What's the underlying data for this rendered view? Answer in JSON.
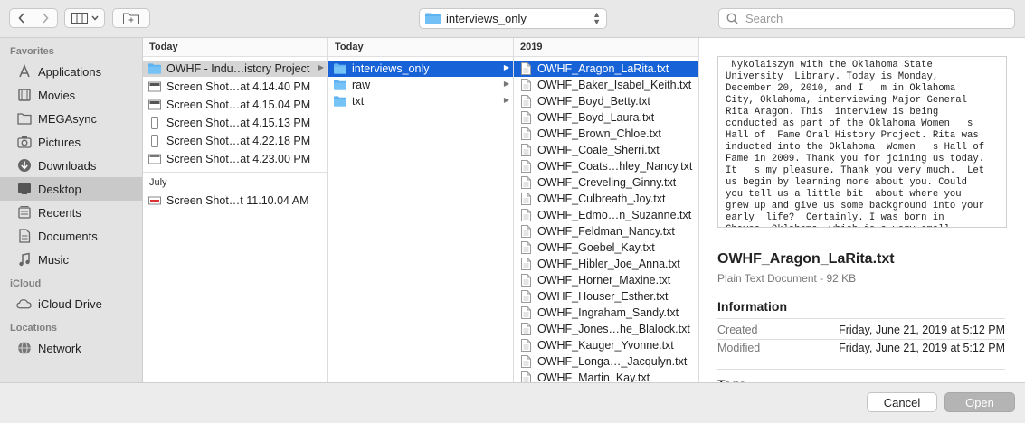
{
  "toolbar": {
    "back_icon": "chevron-left-icon",
    "forward_icon": "chevron-right-icon",
    "view_icon": "column-view-icon",
    "new_folder_icon": "new-folder-icon",
    "location": "interviews_only",
    "search_placeholder": "Search"
  },
  "sidebar": {
    "favorites_heading": "Favorites",
    "favorites": [
      {
        "label": "Applications",
        "icon": "applications-icon"
      },
      {
        "label": "Movies",
        "icon": "movies-icon"
      },
      {
        "label": "MEGAsync",
        "icon": "folder-icon"
      },
      {
        "label": "Pictures",
        "icon": "camera-icon"
      },
      {
        "label": "Downloads",
        "icon": "download-icon"
      },
      {
        "label": "Desktop",
        "icon": "desktop-icon",
        "selected": true
      },
      {
        "label": "Recents",
        "icon": "recents-icon"
      },
      {
        "label": "Documents",
        "icon": "document-icon"
      },
      {
        "label": "Music",
        "icon": "music-icon"
      }
    ],
    "icloud_heading": "iCloud",
    "icloud": [
      {
        "label": "iCloud Drive",
        "icon": "cloud-icon"
      }
    ],
    "locations_heading": "Locations",
    "locations": [
      {
        "label": "Network",
        "icon": "globe-icon"
      }
    ]
  },
  "col1": {
    "header": "Today",
    "items": [
      {
        "label": "OWHF - Indu…istory Project",
        "kind": "folder",
        "selected": true,
        "arrow": true
      },
      {
        "label": "Screen Shot…at 4.14.40 PM",
        "kind": "screenshot"
      },
      {
        "label": "Screen Shot…at 4.15.04 PM",
        "kind": "screenshot"
      },
      {
        "label": "Screen Shot…at 4.15.13 PM",
        "kind": "phone"
      },
      {
        "label": "Screen Shot…at 4.22.18 PM",
        "kind": "phone"
      },
      {
        "label": "Screen Shot…at 4.23.00 PM",
        "kind": "screenshot"
      }
    ],
    "group2_label": "July",
    "group2_items": [
      {
        "label": "Screen Shot…t 11.10.04 AM",
        "kind": "screenshot-red"
      }
    ]
  },
  "col2": {
    "header": "Today",
    "items": [
      {
        "label": "interviews_only",
        "selected": true
      },
      {
        "label": "raw"
      },
      {
        "label": "txt"
      }
    ]
  },
  "col3": {
    "header": "2019",
    "items": [
      "OWHF_Aragon_LaRita.txt",
      "OWHF_Baker_Isabel_Keith.txt",
      "OWHF_Boyd_Betty.txt",
      "OWHF_Boyd_Laura.txt",
      "OWHF_Brown_Chloe.txt",
      "OWHF_Coale_Sherri.txt",
      "OWHF_Coats…hley_Nancy.txt",
      "OWHF_Creveling_Ginny.txt",
      "OWHF_Culbreath_Joy.txt",
      "OWHF_Edmo…n_Suzanne.txt",
      "OWHF_Feldman_Nancy.txt",
      "OWHF_Goebel_Kay.txt",
      "OWHF_Hibler_Joe_Anna.txt",
      "OWHF_Horner_Maxine.txt",
      "OWHF_Houser_Esther.txt",
      "OWHF_Ingraham_Sandy.txt",
      "OWHF_Jones…he_Blalock.txt",
      "OWHF_Kauger_Yvonne.txt",
      "OWHF_Longa…_Jacqulyn.txt",
      "OWHF_Martin_Kay.txt"
    ]
  },
  "preview": {
    "text": " Nykolaiszyn with the Oklahoma State\nUniversity  Library. Today is Monday,\nDecember 20, 2010, and I   m in Oklahoma\nCity, Oklahoma, interviewing Major General\nRita Aragon. This  interview is being\nconducted as part of the Oklahoma Women   s\nHall of  Fame Oral History Project. Rita was\ninducted into the Oklahoma  Women   s Hall of\nFame in 2009. Thank you for joining us today.\nIt   s my pleasure. Thank you very much.  Let\nus begin by learning more about you. Could\nyou tell us a little bit  about where you\ngrew up and give us some background into your\nearly  life?  Certainly. I was born in\nChaves, Oklahoma, which is a very small",
    "filename": "OWHF_Aragon_LaRita.txt",
    "kind": "Plain Text Document - 92 KB",
    "info_heading": "Information",
    "created_label": "Created",
    "created_value": "Friday, June 21, 2019 at 5:12 PM",
    "modified_label": "Modified",
    "modified_value": "Friday, June 21, 2019 at 5:12 PM",
    "next_heading": "Tags"
  },
  "buttons": {
    "cancel": "Cancel",
    "open": "Open"
  }
}
